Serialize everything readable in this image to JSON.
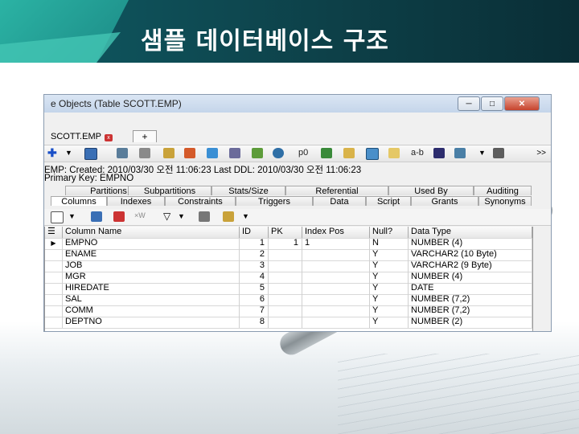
{
  "slide": {
    "title": "샘플 데이터베이스 구조"
  },
  "window": {
    "title": "e Objects (Table SCOTT.EMP)",
    "minimize": "─",
    "maximize": "□",
    "close": "✕",
    "doc_tab": "SCOTT.EMP",
    "add_tab": "+"
  },
  "toolbar": {
    "icons": [
      "plus-icon",
      "dropdown-icon",
      "save-icon",
      "table-icon",
      "list-icon",
      "key-icon",
      "stats-icon",
      "chart-icon",
      "filter-icon",
      "run-icon",
      "binoculars-icon",
      "users-icon",
      "grid-icon",
      "image-icon",
      "copy-icon",
      "ab-icon",
      "columns-icon",
      "network-icon",
      "export-icon"
    ],
    "label_p0": "p0",
    "label_ab": "a-b",
    "overflow": ">>"
  },
  "info": {
    "line1": "EMP:  Created: 2010/03/30 오전 11:06:23   Last DDL: 2010/03/30 오전 11:06:23",
    "line2": "Primary Key:  EMPNO"
  },
  "tabs_top": [
    "Partitions",
    "Subpartitions",
    "Stats/Size",
    "Referential",
    "Used By",
    "Auditing"
  ],
  "tabs_bottom": [
    "Columns",
    "Indexes",
    "Constraints",
    "Triggers",
    "Data",
    "Script",
    "Grants",
    "Synonyms"
  ],
  "grid": {
    "columns": [
      "Column Name",
      "ID",
      "PK",
      "Index Pos",
      "Null?",
      "Data Type"
    ],
    "rows": [
      {
        "name": "EMPNO",
        "id": "1",
        "pk": "1",
        "index_pos": "1",
        "null": "N",
        "type": "NUMBER (4)"
      },
      {
        "name": "ENAME",
        "id": "2",
        "pk": "",
        "index_pos": "",
        "null": "Y",
        "type": "VARCHAR2 (10 Byte)"
      },
      {
        "name": "JOB",
        "id": "3",
        "pk": "",
        "index_pos": "",
        "null": "Y",
        "type": "VARCHAR2 (9 Byte)"
      },
      {
        "name": "MGR",
        "id": "4",
        "pk": "",
        "index_pos": "",
        "null": "Y",
        "type": "NUMBER (4)"
      },
      {
        "name": "HIREDATE",
        "id": "5",
        "pk": "",
        "index_pos": "",
        "null": "Y",
        "type": "DATE"
      },
      {
        "name": "SAL",
        "id": "6",
        "pk": "",
        "index_pos": "",
        "null": "Y",
        "type": "NUMBER (7,2)"
      },
      {
        "name": "COMM",
        "id": "7",
        "pk": "",
        "index_pos": "",
        "null": "Y",
        "type": "NUMBER (7,2)"
      },
      {
        "name": "DEPTNO",
        "id": "8",
        "pk": "",
        "index_pos": "",
        "null": "Y",
        "type": "NUMBER (2)"
      }
    ]
  }
}
